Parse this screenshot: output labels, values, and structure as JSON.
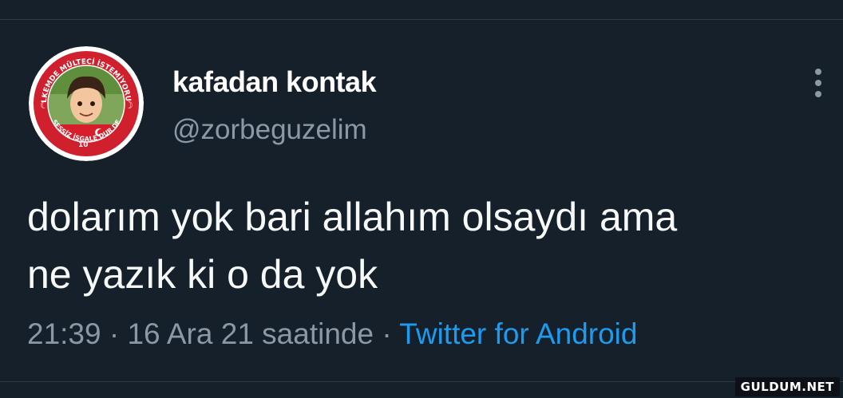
{
  "colors": {
    "background": "#15202b",
    "name": "#ffffff",
    "secondary": "#8b98a5",
    "body_text": "#f7f9f9",
    "link": "#1d9bf0",
    "divider": "#2f3b47"
  },
  "tweet": {
    "author": {
      "display_name": "kafadan kontak",
      "handle": "@zorbeguzelim",
      "avatar": {
        "top_ring_text": "ÜLKEMDE MÜLTECİ İSTEMİYORUM",
        "bottom_ring_text": "SESSİZ İSGALE DUR DE",
        "jersey_number": "10"
      }
    },
    "text_lines": [
      "dolarım yok bari allahım olsaydı ama",
      "ne yazık ki o da yok"
    ],
    "time": "21:39",
    "separator": "·",
    "date": "16 Ara 21 saatinde",
    "source": "Twitter for Android",
    "more_icon": "more-vertical-icon"
  },
  "watermark": "GULDUM.NET"
}
